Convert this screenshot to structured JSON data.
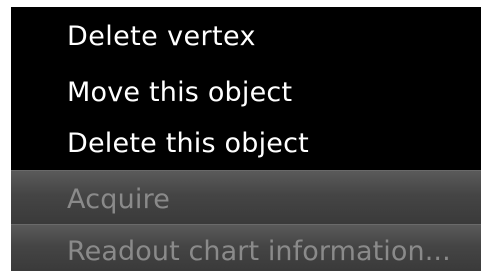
{
  "context_menu": {
    "items": [
      {
        "label": "Delete vertex",
        "enabled": true
      },
      {
        "label": "Move this object",
        "enabled": true
      },
      {
        "label": "Delete this object",
        "enabled": true
      },
      {
        "label": "Acquire",
        "enabled": false
      },
      {
        "label": "Readout chart information...",
        "enabled": false
      }
    ]
  },
  "colors": {
    "menu_background": "#000000",
    "enabled_text": "#ffffff",
    "disabled_text": "#8a8a8a",
    "disabled_background": "#454545"
  }
}
